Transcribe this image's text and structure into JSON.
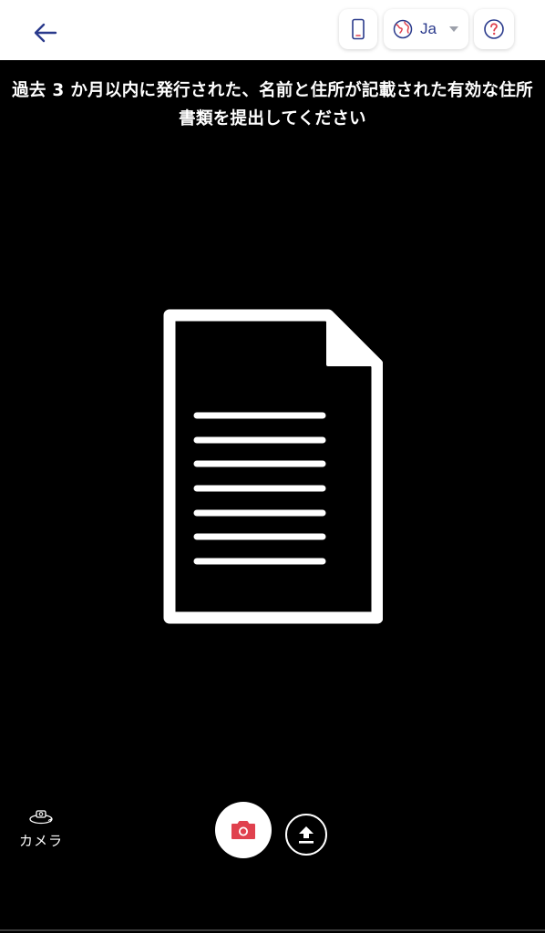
{
  "header": {
    "back_icon": "arrow-left-icon",
    "device_icon": "mobile-phone-icon",
    "language": {
      "icon": "globe-icon",
      "label": "Ja",
      "caret_icon": "caret-down-icon"
    },
    "help_icon": "question-circle-icon"
  },
  "instruction": {
    "line1": "過去 3 か月以内に発行された、名前と住所が記載された有効な住所",
    "line2": "書類を提出してください"
  },
  "illustration": {
    "icon": "document-icon"
  },
  "controls": {
    "camera_switch": {
      "icon": "camera-switch-icon",
      "label": "カメラ"
    },
    "capture_icon": "camera-icon",
    "upload_icon": "upload-icon"
  },
  "colors": {
    "header_bg": "#ffffff",
    "accent_blue": "#2a3a8c",
    "capture_red": "#e0414e",
    "background": "#000000"
  }
}
